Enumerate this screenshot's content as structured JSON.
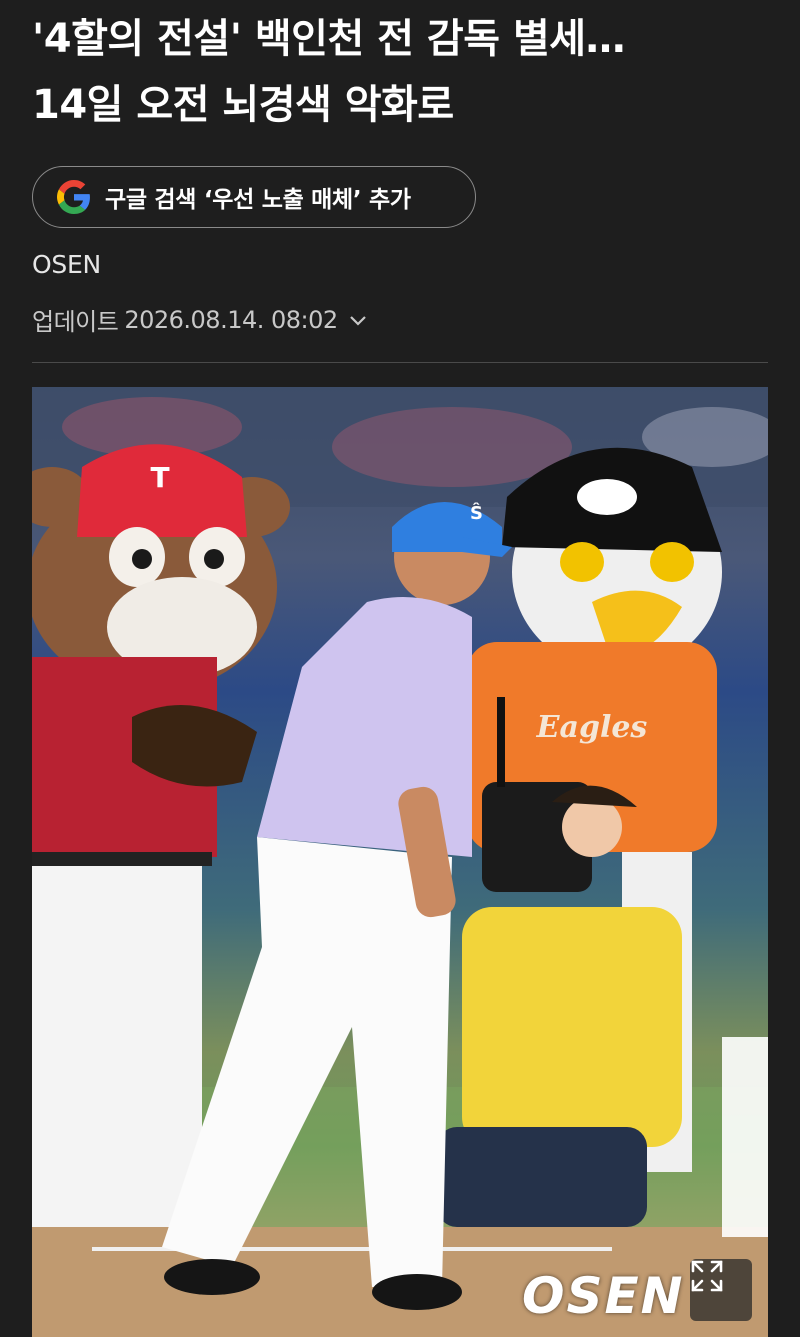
{
  "article": {
    "headline_line1": "'4할의 전설' 백인천 전 감독 별세…",
    "headline_line2": "14일 오전 뇌경색 악화로",
    "source": "OSEN",
    "updated_label": "업데이트",
    "updated_time": "2026.08.14. 08:02"
  },
  "google_chip": {
    "label": "구글 검색 ‘우선 노출 매체’ 추가",
    "icon": "google-g-icon"
  },
  "photo": {
    "watermark": "OSEN",
    "expand_icon": "expand-icon"
  },
  "colors": {
    "background": "#1e1e1e",
    "text": "#ffffff",
    "chip_border": "#8a8a8a"
  }
}
